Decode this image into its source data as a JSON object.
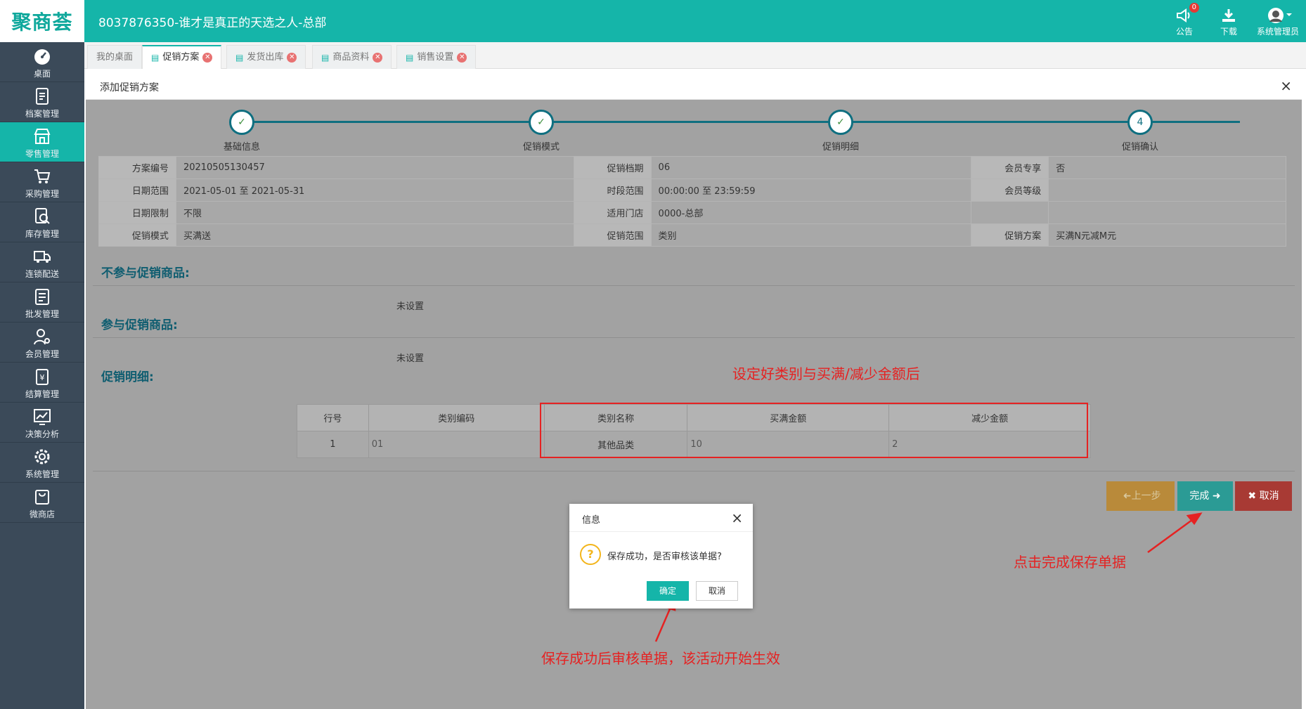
{
  "header": {
    "logo": "聚商荟",
    "title": "8037876350-谁才是真正的天选之人-总部",
    "notice_label": "公告",
    "notice_count": "0",
    "download_label": "下载",
    "user_label": "系统管理员"
  },
  "sidebar": {
    "items": [
      {
        "label": "桌面",
        "icon": "dashboard-icon"
      },
      {
        "label": "档案管理",
        "icon": "file-icon"
      },
      {
        "label": "零售管理",
        "icon": "store-icon"
      },
      {
        "label": "采购管理",
        "icon": "cart-icon"
      },
      {
        "label": "库存管理",
        "icon": "inventory-icon"
      },
      {
        "label": "连锁配送",
        "icon": "truck-icon"
      },
      {
        "label": "批发管理",
        "icon": "wholesale-icon"
      },
      {
        "label": "会员管理",
        "icon": "member-icon"
      },
      {
        "label": "结算管理",
        "icon": "settlement-icon"
      },
      {
        "label": "决策分析",
        "icon": "chart-icon"
      },
      {
        "label": "系统管理",
        "icon": "gear-icon"
      },
      {
        "label": "微商店",
        "icon": "shop-bag-icon"
      }
    ],
    "active_index": 2
  },
  "tabs": [
    {
      "label": "我的桌面"
    },
    {
      "label": "促销方案"
    },
    {
      "label": "发货出库"
    },
    {
      "label": "商品资料"
    },
    {
      "label": "销售设置"
    }
  ],
  "panel": {
    "title": "添加促销方案",
    "close": "×"
  },
  "steps": [
    {
      "label": "基础信息",
      "mark": "✓"
    },
    {
      "label": "促销模式",
      "mark": "✓"
    },
    {
      "label": "促销明细",
      "mark": "✓"
    },
    {
      "label": "促销确认",
      "mark": "4"
    }
  ],
  "info": {
    "row1": {
      "k1": "方案编号",
      "v1": "20210505130457",
      "k2": "促销档期",
      "v2": "06",
      "k3": "会员专享",
      "v3": "否"
    },
    "row2": {
      "k1": "日期范围",
      "v1": "2021-05-01 至 2021-05-31",
      "k2": "时段范围",
      "v2": "00:00:00 至 23:59:59",
      "k3": "会员等级",
      "v3": ""
    },
    "row3": {
      "k1": "日期限制",
      "v1": "不限",
      "k2": "适用门店",
      "v2": "0000-总部",
      "k3": "",
      "v3": ""
    },
    "row4": {
      "k1": "促销模式",
      "v1": "买满送",
      "k2": "促销范围",
      "v2": "类别",
      "k3": "促销方案",
      "v3": "买满N元减M元"
    }
  },
  "sections": {
    "excluded_title": "不参与促销商品:",
    "excluded_value": "未设置",
    "included_title": "参与促销商品:",
    "included_value": "未设置",
    "detail_title": "促销明细:"
  },
  "detail_table": {
    "headers": [
      "行号",
      "类别编码",
      "类别名称",
      "买满金额",
      "减少金额"
    ],
    "rows": [
      [
        "1",
        "01",
        "其他品类",
        "10",
        "2"
      ]
    ]
  },
  "buttons": {
    "prev": "上一步",
    "done": "完成",
    "cancel": "取消"
  },
  "dialog": {
    "title": "信息",
    "message": "保存成功，是否审核该单据?",
    "ok": "确定",
    "cancel": "取消"
  },
  "annotations": {
    "table_note": "设定好类别与买满/减少金额后",
    "done_note": "点击完成保存单据",
    "dialog_note": "保存成功后审核单据，该活动开始生效"
  },
  "colors": {
    "brand": "#15b5a9",
    "sidebar": "#3b4a59",
    "annotation": "#e52222"
  }
}
